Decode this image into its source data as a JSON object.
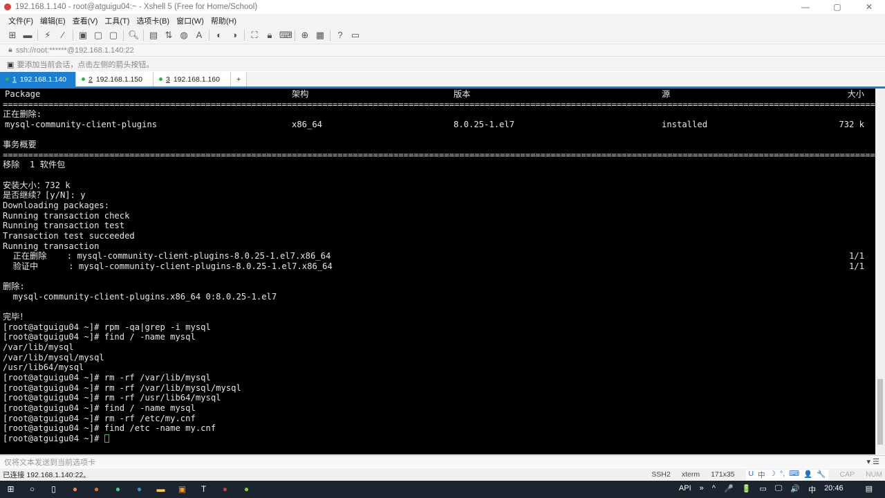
{
  "window": {
    "title": "192.168.1.140 - root@atguigu04:~ - Xshell 5 (Free for Home/School)",
    "controls": [
      "—",
      "▢",
      "✕"
    ]
  },
  "menu": [
    "文件(F)",
    "编辑(E)",
    "查看(V)",
    "工具(T)",
    "选项卡(B)",
    "窗口(W)",
    "帮助(H)"
  ],
  "toolbar_icons": [
    "new-session-icon",
    "open-folder-icon",
    "reconnect-icon",
    "disconnect-icon",
    "properties-icon",
    "copy-icon",
    "paste-icon",
    "find-icon",
    "print-icon",
    "transfer-icon",
    "globe-icon",
    "font-icon",
    "xftp-icon",
    "xagent-icon",
    "fullscreen-icon",
    "lock-icon",
    "keyboard-icon",
    "new-tab-icon",
    "layout-icon",
    "help-icon",
    "chat-icon"
  ],
  "address": "ssh://root:******@192.168.1.140:22",
  "hint": "要添加当前会话，点击左侧的箭头按钮。",
  "tabs": [
    {
      "num": "1",
      "label": "192.168.1.140"
    },
    {
      "num": "2",
      "label": "192.168.1.150"
    },
    {
      "num": "3",
      "label": "192.168.1.160"
    }
  ],
  "tab_add": "+",
  "terminal": {
    "header": [
      "Package",
      "架构",
      "版本",
      "源",
      "大小"
    ],
    "separator": "=====================================================================================================================================================================================",
    "removing_label": "正在删除:",
    "row": [
      "mysql-community-client-plugins",
      "x86_64",
      "8.0.25-1.el7",
      "installed",
      "732 k"
    ],
    "lines": [
      {
        "t": ""
      },
      {
        "t": "事务概要"
      },
      {
        "t": "SEP"
      },
      {
        "t": "移除  1 软件包"
      },
      {
        "t": ""
      },
      {
        "t": "安装大小：732 k"
      },
      {
        "t": "是否继续？[y/N]: y"
      },
      {
        "t": "Downloading packages:"
      },
      {
        "t": "Running transaction check"
      },
      {
        "t": "Running transaction test"
      },
      {
        "t": "Transaction test succeeded"
      },
      {
        "t": "Running transaction"
      },
      {
        "t": "  正在删除    : mysql-community-client-plugins-8.0.25-1.el7.x86_64",
        "r": "1/1"
      },
      {
        "t": "  验证中      : mysql-community-client-plugins-8.0.25-1.el7.x86_64",
        "r": "1/1"
      },
      {
        "t": ""
      },
      {
        "t": "删除:"
      },
      {
        "t": "  mysql-community-client-plugins.x86_64 0:8.0.25-1.el7"
      },
      {
        "t": ""
      },
      {
        "t": "完毕！"
      },
      {
        "t": "[root@atguigu04 ~]# rpm -qa|grep -i mysql"
      },
      {
        "t": "[root@atguigu04 ~]# find / -name mysql"
      },
      {
        "t": "/var/lib/mysql"
      },
      {
        "t": "/var/lib/mysql/mysql"
      },
      {
        "t": "/usr/lib64/mysql"
      },
      {
        "t": "[root@atguigu04 ~]# rm -rf /var/lib/mysql"
      },
      {
        "t": "[root@atguigu04 ~]# rm -rf /var/lib/mysql/mysql"
      },
      {
        "t": "[root@atguigu04 ~]# rm -rf /usr/lib64/mysql"
      },
      {
        "t": "[root@atguigu04 ~]# find / -name mysql"
      },
      {
        "t": "[root@atguigu04 ~]# rm -rf /etc/my.cnf"
      },
      {
        "t": "[root@atguigu04 ~]# find /etc -name my.cnf"
      }
    ],
    "prompt": "[root@atguigu04 ~]# "
  },
  "send_bar": "仅将文本发送到当前选项卡",
  "status": {
    "connected": "已连接 192.168.1.140:22。",
    "protocol": "SSH2",
    "term": "xterm",
    "size": "171x35",
    "caps": "CAP",
    "num": "NUM",
    "ime": [
      "U",
      "中",
      "☽",
      "°,",
      "⌨",
      "👤",
      "🔧"
    ]
  },
  "taskbar": {
    "tray": [
      "API",
      "»",
      "^",
      "🎤",
      "🔋",
      "▭",
      "🖵",
      "🔊",
      "中",
      "20:46"
    ],
    "apps": [
      "start-icon",
      "search-icon",
      "task-view-icon",
      "browser-360-icon",
      "firefox-icon",
      "chrome-icon",
      "edge-icon",
      "file-explorer-icon",
      "vm-icon",
      "typora-icon",
      "xshell-icon",
      "xftp-icon"
    ]
  }
}
